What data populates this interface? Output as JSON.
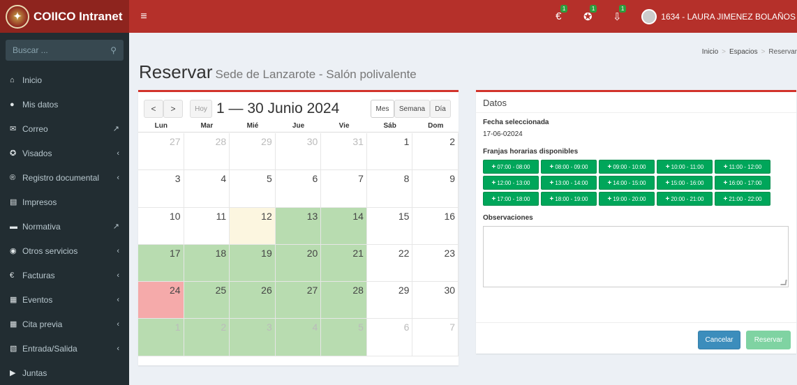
{
  "header": {
    "app_name": "COIICO Intranet",
    "menu_icon": "hamburger-icon",
    "notifications": [
      {
        "icon": "euro-icon",
        "badge": "1"
      },
      {
        "icon": "award-icon",
        "badge": "1"
      },
      {
        "icon": "download-icon",
        "badge": "1"
      }
    ],
    "user": "1634 - LAURA JIMENEZ BOLAÑOS",
    "brand_color": "#b5302a"
  },
  "sidebar": {
    "search_placeholder": "Buscar ...",
    "items": [
      {
        "label": "Inicio",
        "icon": "home-icon",
        "right": ""
      },
      {
        "label": "Mis datos",
        "icon": "user-icon",
        "right": ""
      },
      {
        "label": "Correo",
        "icon": "envelope-icon",
        "right": "external-link-icon"
      },
      {
        "label": "Visados",
        "icon": "ribbon-icon",
        "right": "chevron-left-icon"
      },
      {
        "label": "Registro documental",
        "icon": "registered-icon",
        "right": "chevron-left-icon"
      },
      {
        "label": "Impresos",
        "icon": "file-icon",
        "right": ""
      },
      {
        "label": "Normativa",
        "icon": "book-icon",
        "right": "external-link-icon"
      },
      {
        "label": "Otros servicios",
        "icon": "globe-icon",
        "right": "chevron-left-icon"
      },
      {
        "label": "Facturas",
        "icon": "euro-icon",
        "right": "chevron-left-icon"
      },
      {
        "label": "Eventos",
        "icon": "calendar-icon",
        "right": "chevron-left-icon"
      },
      {
        "label": "Cita previa",
        "icon": "calendar-icon",
        "right": "chevron-left-icon"
      },
      {
        "label": "Entrada/Salida",
        "icon": "file-text-icon",
        "right": "chevron-left-icon"
      },
      {
        "label": "Juntas",
        "icon": "video-icon",
        "right": ""
      }
    ]
  },
  "breadcrumb": {
    "home": "Inicio",
    "section": "Espacios",
    "current": "Reservar"
  },
  "page": {
    "title": "Reservar",
    "subtitle": "Sede de Lanzarote - Salón polivalente"
  },
  "calendar": {
    "prev": "<",
    "next": ">",
    "today_label": "Hoy",
    "range_title": "1 — 30 Junio 2024",
    "views": [
      "Mes",
      "Semana",
      "Día"
    ],
    "weekdays": [
      "Lun",
      "Mar",
      "Mié",
      "Jue",
      "Vie",
      "Sáb",
      "Dom"
    ],
    "weeks": [
      [
        {
          "d": "27",
          "s": "other"
        },
        {
          "d": "28",
          "s": "other"
        },
        {
          "d": "29",
          "s": "other"
        },
        {
          "d": "30",
          "s": "other"
        },
        {
          "d": "31",
          "s": "other"
        },
        {
          "d": "1",
          "s": ""
        },
        {
          "d": "2",
          "s": ""
        }
      ],
      [
        {
          "d": "3",
          "s": ""
        },
        {
          "d": "4",
          "s": ""
        },
        {
          "d": "5",
          "s": ""
        },
        {
          "d": "6",
          "s": ""
        },
        {
          "d": "7",
          "s": ""
        },
        {
          "d": "8",
          "s": ""
        },
        {
          "d": "9",
          "s": ""
        }
      ],
      [
        {
          "d": "10",
          "s": ""
        },
        {
          "d": "11",
          "s": ""
        },
        {
          "d": "12",
          "s": "today"
        },
        {
          "d": "13",
          "s": "green"
        },
        {
          "d": "14",
          "s": "green"
        },
        {
          "d": "15",
          "s": ""
        },
        {
          "d": "16",
          "s": ""
        }
      ],
      [
        {
          "d": "17",
          "s": "green"
        },
        {
          "d": "18",
          "s": "green"
        },
        {
          "d": "19",
          "s": "green"
        },
        {
          "d": "20",
          "s": "green"
        },
        {
          "d": "21",
          "s": "green"
        },
        {
          "d": "22",
          "s": ""
        },
        {
          "d": "23",
          "s": ""
        }
      ],
      [
        {
          "d": "24",
          "s": "red"
        },
        {
          "d": "25",
          "s": "green"
        },
        {
          "d": "26",
          "s": "green"
        },
        {
          "d": "27",
          "s": "green"
        },
        {
          "d": "28",
          "s": "green"
        },
        {
          "d": "29",
          "s": ""
        },
        {
          "d": "30",
          "s": ""
        }
      ],
      [
        {
          "d": "1",
          "s": "green other"
        },
        {
          "d": "2",
          "s": "green other"
        },
        {
          "d": "3",
          "s": "green other"
        },
        {
          "d": "4",
          "s": "green other"
        },
        {
          "d": "5",
          "s": "green other"
        },
        {
          "d": "6",
          "s": "other"
        },
        {
          "d": "7",
          "s": "other"
        }
      ]
    ]
  },
  "details": {
    "title": "Datos",
    "date_label": "Fecha seleccionada",
    "date_value": "17-06-02024",
    "slots_label": "Franjas horarias disponibles",
    "slots": [
      "07:00 - 08:00",
      "08:00 - 09:00",
      "09:00 - 10:00",
      "10:00 - 11:00",
      "11:00 - 12:00",
      "12:00 - 13:00",
      "13:00 - 14:00",
      "14:00 - 15:00",
      "15:00 - 16:00",
      "16:00 - 17:00",
      "17:00 - 18:00",
      "18:00 - 19:00",
      "19:00 - 20:00",
      "20:00 - 21:00",
      "21:00 - 22:00"
    ],
    "obs_label": "Observaciones",
    "obs_value": "",
    "cancel": "Cancelar",
    "reserve": "Reservar"
  }
}
